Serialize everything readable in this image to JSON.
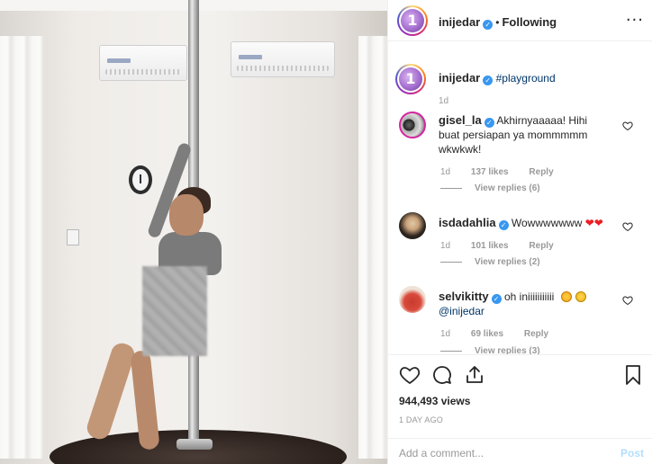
{
  "header": {
    "username": "inijedar",
    "separator": "•",
    "follow_status": "Following"
  },
  "caption": {
    "username": "inijedar",
    "text": "#playground",
    "time": "1d"
  },
  "comments": [
    {
      "username": "gisel_la",
      "text_line1": "Akhirnyaaaaa! Hihi",
      "text_line2": "buat persiapan ya mommmmm",
      "text_line3": "wkwkwk!",
      "time": "1d",
      "likes": "137 likes",
      "reply": "Reply",
      "view_replies": "View replies (6)"
    },
    {
      "username": "isdadahlia",
      "text": "Wowwwwwww",
      "emojis": "❤❤",
      "time": "1d",
      "likes": "101 likes",
      "reply": "Reply",
      "view_replies": "View replies (2)"
    },
    {
      "username": "selvikitty",
      "text": "oh iniiiiiiiiiii",
      "mention": "@inijedar",
      "time": "1d",
      "likes": "69 likes",
      "reply": "Reply",
      "view_replies": "View replies (3)"
    }
  ],
  "stats": {
    "views": "944,493 views",
    "date": "1 DAY AGO"
  },
  "composer": {
    "placeholder": "Add a comment...",
    "post_label": "Post"
  },
  "colors": {
    "verified": "#3897f0",
    "link": "#003569",
    "post_disabled": "#b2dffc"
  },
  "icons": [
    "more-icon",
    "heart-icon",
    "comment-icon",
    "share-icon",
    "bookmark-icon",
    "verified-icon"
  ]
}
